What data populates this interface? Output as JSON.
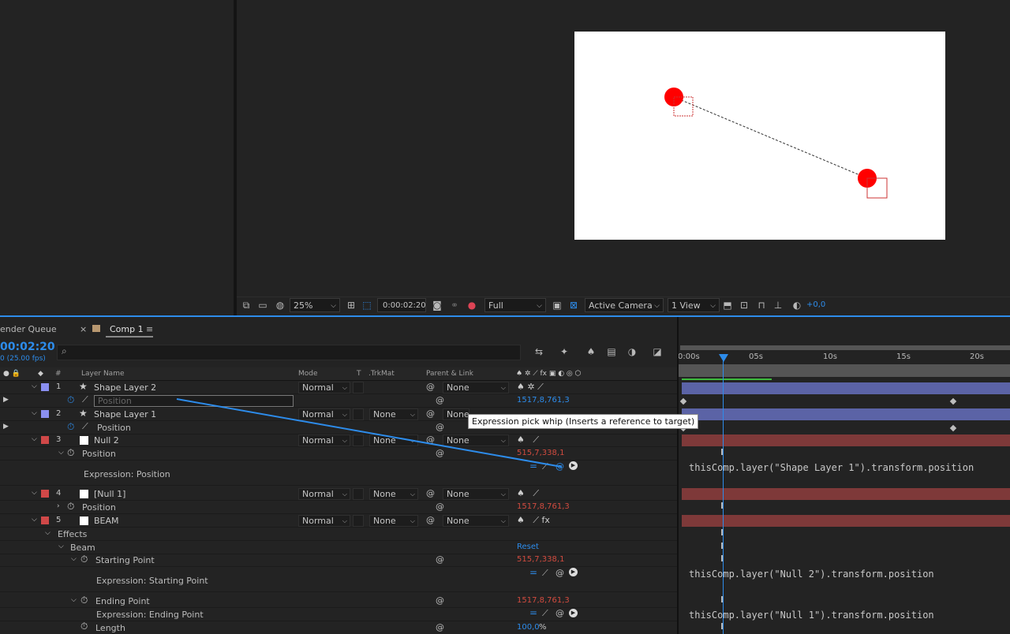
{
  "viewer": {
    "zoom": "25%",
    "timecode": "0:00:02:20",
    "resolution": "Full",
    "camera": "Active Camera",
    "view": "1 View",
    "exposure": "+0,0"
  },
  "tabs": {
    "render_queue": "ender Queue",
    "comp_close": "×",
    "comp": "Comp 1",
    "comp_menu": "≡"
  },
  "timeline": {
    "current_time": "00:02:20",
    "fps": "0 (25.00 fps)",
    "ruler": [
      "0:00s",
      "05s",
      "10s",
      "15s",
      "20s"
    ]
  },
  "columns": {
    "num": "#",
    "layer_name": "Layer Name",
    "mode": "Mode",
    "t": "T",
    "trkmat": ".TrkMat",
    "parent": "Parent & Link"
  },
  "layers": [
    {
      "num": "1",
      "name": "Shape Layer 2",
      "mode": "Normal",
      "trkmat": "",
      "parent": "None",
      "color": "#8a8ff0"
    },
    {
      "num": "2",
      "name": "Shape Layer 1",
      "mode": "Normal",
      "trkmat": "None",
      "parent": "None",
      "color": "#8a8ff0"
    },
    {
      "num": "3",
      "name": "Null 2",
      "mode": "Normal",
      "trkmat": "None",
      "parent": "None",
      "color": "#d04848"
    },
    {
      "num": "4",
      "name": "[Null 1]",
      "mode": "Normal",
      "trkmat": "None",
      "parent": "None",
      "color": "#d04848"
    },
    {
      "num": "5",
      "name": "BEAM",
      "mode": "Normal",
      "trkmat": "None",
      "parent": "None",
      "color": "#d04848"
    }
  ],
  "props": {
    "l1_position_placeholder": "Position",
    "l1_position_value": "1517,8,761,3",
    "l2_position": "Position",
    "l3_position": "Position",
    "l3_position_value": "515,7,338,1",
    "l3_expression_label": "Expression: Position",
    "l3_expression": "thisComp.layer(\"Shape Layer 1\").transform.position",
    "l4_position": "Position",
    "l4_position_value": "1517,8,761,3",
    "effects": "Effects",
    "beam": "Beam",
    "reset": "Reset",
    "starting_point": "Starting Point",
    "starting_point_value": "515,7,338,1",
    "starting_expr_label": "Expression: Starting Point",
    "starting_expr": "thisComp.layer(\"Null 2\").transform.position",
    "ending_point": "Ending Point",
    "ending_point_value": "1517,8,761,3",
    "ending_expr_label": "Expression: Ending Point",
    "ending_expr": "thisComp.layer(\"Null 1\").transform.position",
    "length": "Length",
    "length_value": "100,0",
    "length_unit": "%"
  },
  "tooltip": "Expression pick whip (Inserts a reference to target)",
  "colors": {
    "accent": "#2d8ceb",
    "track_blue": "#5b63a6",
    "track_red": "#7e3939",
    "value_red": "#d24b3f"
  }
}
